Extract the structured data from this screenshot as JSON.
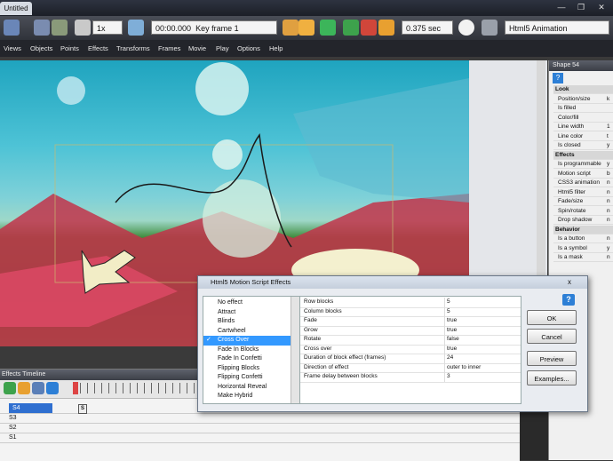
{
  "window": {
    "title_tab": "Untitled"
  },
  "toolbar": {
    "speed": "1x",
    "time": "00:00.000",
    "keyframe": "Key frame 1",
    "duration": "0.375 sec",
    "export_mode": "Html5 Animation"
  },
  "menu": [
    "Views",
    "Objects",
    "Points",
    "Effects",
    "Transforms",
    "Frames",
    "Movie",
    "Play",
    "Options",
    "Help"
  ],
  "properties": {
    "title": "Shape 54",
    "rows": [
      {
        "label": "Look",
        "section": true
      },
      {
        "label": "Position/size",
        "value": "k"
      },
      {
        "label": "Is filled",
        "value": ""
      },
      {
        "label": "Color/fill",
        "value": ""
      },
      {
        "label": "Line width",
        "value": "1"
      },
      {
        "label": "Line color",
        "value": "t"
      },
      {
        "label": "Is closed",
        "value": "y"
      },
      {
        "label": "Effects",
        "section": true
      },
      {
        "label": "Is programmable",
        "value": "y"
      },
      {
        "label": "Motion script",
        "value": "b"
      },
      {
        "label": "CSS3 animation",
        "value": "n"
      },
      {
        "label": "Html5 filter",
        "value": "n"
      },
      {
        "label": "Fade/size",
        "value": "n"
      },
      {
        "label": "Spin/rotate",
        "value": "n"
      },
      {
        "label": "Drop shadow",
        "value": "n"
      },
      {
        "label": "Behavior",
        "section": true
      },
      {
        "label": "Is a button",
        "value": "n"
      },
      {
        "label": "Is a symbol",
        "value": "y"
      },
      {
        "label": "Is a mask",
        "value": "n"
      }
    ]
  },
  "timeline": {
    "title": "Effects Timeline",
    "rows": [
      {
        "name": "S4",
        "selected": true,
        "marker": "S"
      },
      {
        "name": "S3",
        "selected": false,
        "marker": ""
      },
      {
        "name": "S2",
        "selected": false,
        "marker": ""
      },
      {
        "name": "S1",
        "selected": false,
        "marker": ""
      }
    ]
  },
  "dialog": {
    "title": "Html5 Motion Script Effects",
    "close": "x",
    "effects": [
      "No effect",
      "Attract",
      "Blinds",
      "Cartwheel",
      "Cross Over",
      "Fade In Blocks",
      "Fade In Confetti",
      "Flipping Blocks",
      "Flipping Confetti",
      "Horizontal Reveal",
      "Make Hybrid"
    ],
    "selected_effect": "Cross Over",
    "params": [
      {
        "k": "Row blocks",
        "v": "5"
      },
      {
        "k": "Column blocks",
        "v": "5"
      },
      {
        "k": "Fade",
        "v": "true"
      },
      {
        "k": "Grow",
        "v": "true"
      },
      {
        "k": "Rotate",
        "v": "false"
      },
      {
        "k": "Cross over",
        "v": "true"
      },
      {
        "k": "Duration of block effect (frames)",
        "v": "24"
      },
      {
        "k": "Direction of effect",
        "v": "outer to inner"
      },
      {
        "k": "Frame delay between blocks",
        "v": "3"
      }
    ],
    "buttons": {
      "ok": "OK",
      "cancel": "Cancel",
      "preview": "Preview",
      "examples": "Examples..."
    },
    "help": "?"
  },
  "colors": {
    "selection": "#3399ff",
    "accent": "#2d7fd6"
  }
}
